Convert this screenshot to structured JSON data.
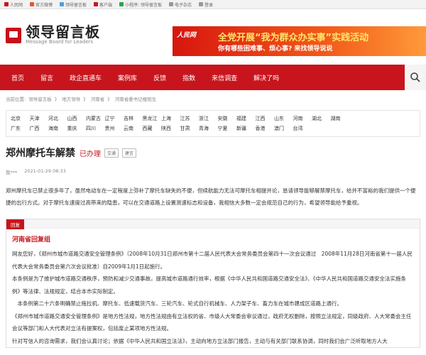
{
  "topbar": [
    {
      "label": "人民网",
      "color": "#c8151d"
    },
    {
      "label": "官方微博",
      "color": "#e5582a"
    },
    {
      "label": "领导留言板",
      "color": "#4aa0e0"
    },
    {
      "label": "客户端",
      "color": "#c8151d"
    },
    {
      "label": "小程序: 领导留言板",
      "color": "#2aa84a"
    },
    {
      "label": "电子杂志",
      "color": "#999999"
    },
    {
      "label": "登录",
      "color": "#999999"
    }
  ],
  "logo": {
    "cn": "领导留言板",
    "en": "Message Board for Leaders"
  },
  "banner": {
    "logo": "人民网",
    "line1": "全党开展“我为群众办实事”实践活动",
    "line2": "你有哪些困难事、烦心事? 来找领导说说"
  },
  "nav": [
    "首页",
    "留言",
    "政企直通车",
    "案例库",
    "反馈",
    "指数",
    "来信调查",
    "解决了吗"
  ],
  "crumb": [
    "当前位置:",
    "领导留言板",
    "》",
    "地方领导",
    "》",
    "河南省",
    "》",
    "河南省委书记楼阳生"
  ],
  "regions": [
    [
      "北京",
      "天津",
      "河北",
      "山西",
      "内蒙古",
      "辽宁",
      "吉林",
      "黑龙江",
      "上海",
      "江苏",
      "浙江",
      "安徽",
      "福建",
      "江西",
      "山东",
      "河南",
      "湖北",
      "湖南"
    ],
    [
      "广东",
      "广西",
      "海南",
      "重庆",
      "四川",
      "贵州",
      "云南",
      "西藏",
      "陕西",
      "甘肃",
      "青海",
      "宁夏",
      "新疆",
      "香港",
      "澳门",
      "台湾"
    ]
  ],
  "message": {
    "title": "郑州摩托车解禁",
    "status": "已办理",
    "tags": [
      "交通",
      "建言"
    ],
    "author": "我***",
    "time": "2021-01-29 08:33",
    "body": "郑州摩托车已禁止很多年了，虽然电动车在一定程度上弥补了摩托车缺失的不便，但续航能力无法可摩托车相提并论，恳请领导能够解禁摩托车，给并不富裕的我们提供一个便捷的出行方式。对于摩托车速度过高带来的隐患，可以在交通道路上设置测速标志和设备，我相信大多数一定会规范自己的行为，希望领导能给予重视。"
  },
  "reply": {
    "tag": "回复",
    "from": "河南省回复组",
    "paragraphs": [
      "网友您好，《郑州市城市道路交通安全管理条例》（2008年10月31日郑州市第十二届人民代表大会常务委员会第四十一次会议通过　2008年11月28日河南省第十一届人民代表大会常务委员会第六次会议批准）自2009年1月1日起施行。",
      "本条例是为了维护城市道路交通秩序，预防和减少交通事故，提高城市道路通行效率，根据《中华人民共和国道路交通安全法》、《中华人民共和国道路交通安全法实施条例》等法律、法规规定，结合本市实际制定。",
      "　本条例第二十六条明确禁止拖拉机、摩托车、低速载货汽车、三轮汽车、轮式自行机械车、人力架子车、畜力车在城市建成区道路上通行。",
      "《郑州市城市道路交通安全管理条例》是地方性法规，地方性法规由有立法权的省、市级人大常委会审议通过，政府无权删除，按照立法规定，同级政府、人大常委会主任会议等部门和人大代表对立法有提案权，包括废止某项地方性法规。",
      "针对写信人的咨询需求，我们会认真讨论；依据《中华人民共和国立法法》，主动向地方立法部门报告，主动与有关部门联系协调，同时我们会广泛听取地方人大"
    ]
  }
}
